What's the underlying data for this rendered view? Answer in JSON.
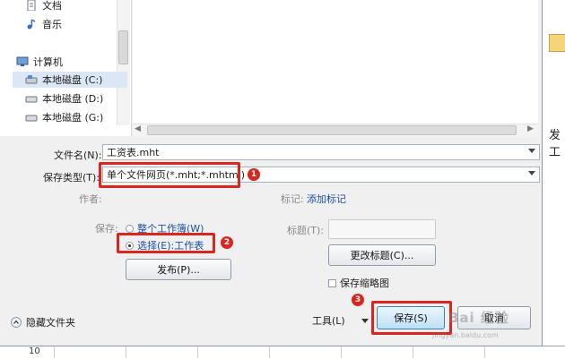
{
  "nav": {
    "items": [
      {
        "label": "文档",
        "icon": "document-icon"
      },
      {
        "label": "音乐",
        "icon": "music-icon"
      },
      {
        "label": "计算机",
        "icon": "computer-icon"
      },
      {
        "label": "本地磁盘 (C:)",
        "icon": "drive-icon"
      },
      {
        "label": "本地磁盘 (D:)",
        "icon": "drive-icon"
      },
      {
        "label": "本地磁盘 (G:)",
        "icon": "drive-icon"
      }
    ]
  },
  "form": {
    "filename_label": "文件名(N):",
    "filename_value": "工资表.mht",
    "savetype_label": "保存类型(T):",
    "savetype_value": "单个文件网页(*.mht;*.mhtml)",
    "author_label": "作者:",
    "tags_label": "标记:",
    "tags_link": "添加标记",
    "save_label": "保存:",
    "option_workbook": "整个工作簿(W)",
    "option_selection": "选择(E):工作表",
    "title_label": "标题(T):",
    "title_value": "",
    "change_title_button": "更改标题(C)...",
    "publish_button": "发布(P)...",
    "thumbnail_label": "保存缩略图"
  },
  "footer": {
    "hide_folders": "隐藏文件夹",
    "tools": "工具(L)",
    "save_button": "保存(S)",
    "cancel_button": "取消"
  },
  "annotations": {
    "step1": "1",
    "step2": "2",
    "step3": "3"
  },
  "background": {
    "row_number": "10",
    "cell_text": "发工"
  },
  "watermark": {
    "text": "Bai 经验",
    "sub": "jingyan.baidu.com"
  },
  "colors": {
    "highlight": "#d9271f",
    "link": "#1a4fa3"
  }
}
